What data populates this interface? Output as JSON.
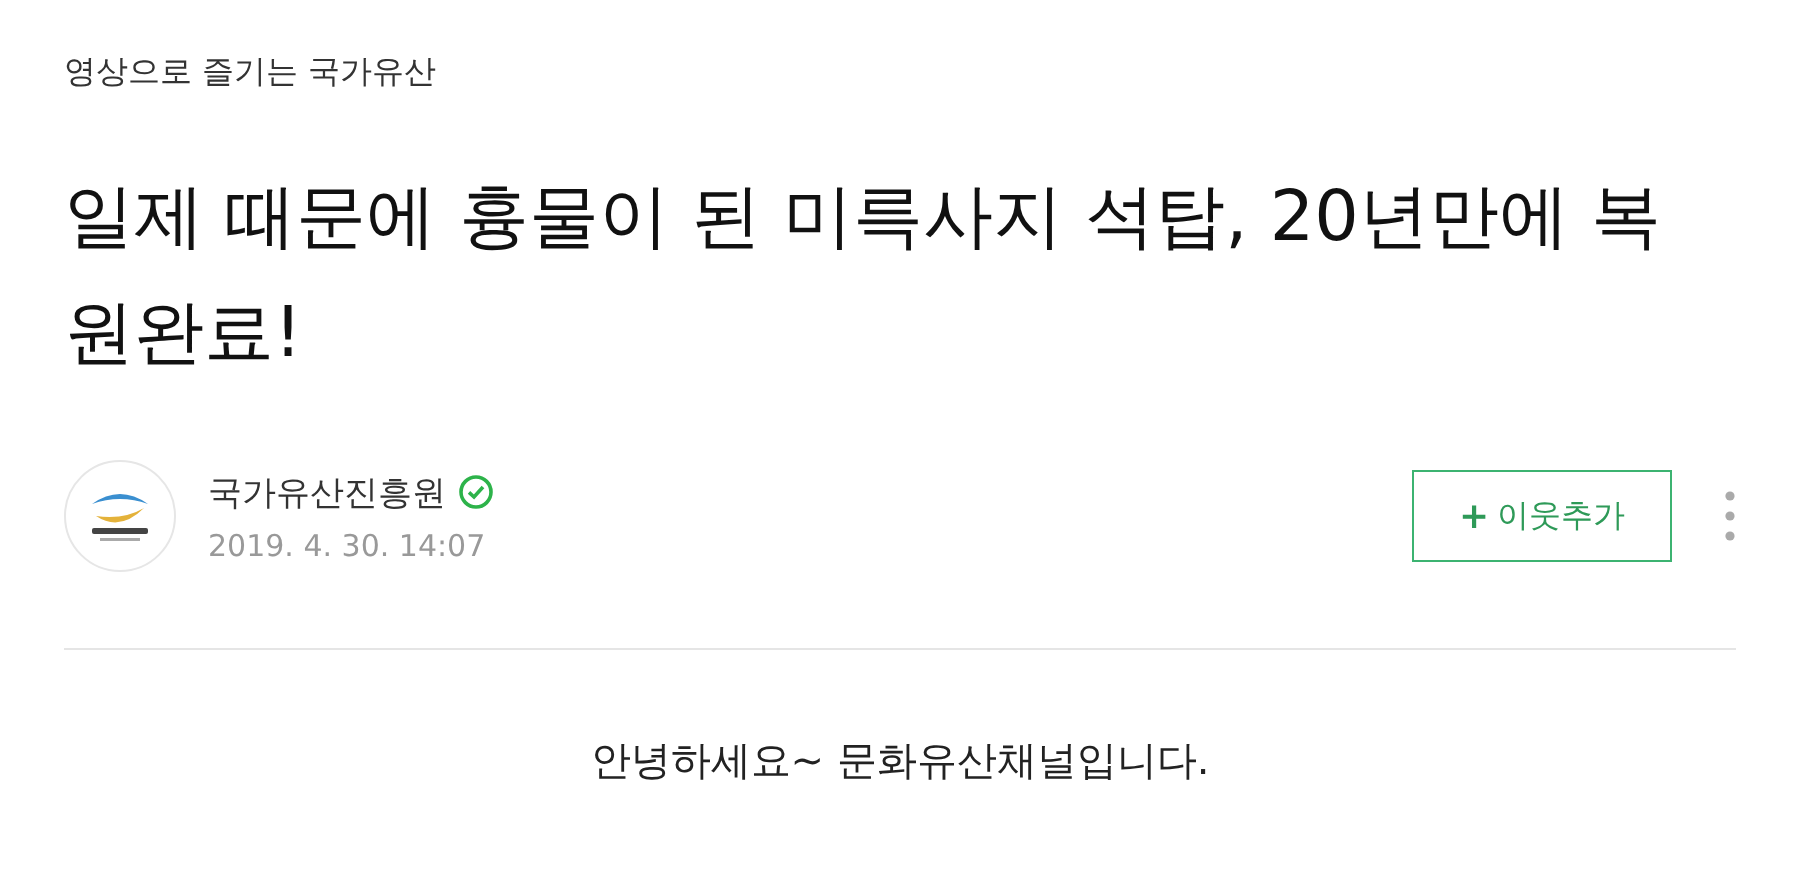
{
  "category": "영상으로 즐기는 국가유산",
  "title": "일제 때문에 흉물이 된 미륵사지 석탑, 20년만에 복원완료!",
  "author": {
    "name": "국가유산진흥원",
    "verified": true,
    "date": "2019. 4. 30. 14:07"
  },
  "follow_button": {
    "icon": "+",
    "label": "이웃추가"
  },
  "body": "안녕하세요~ 문화유산채널입니다."
}
